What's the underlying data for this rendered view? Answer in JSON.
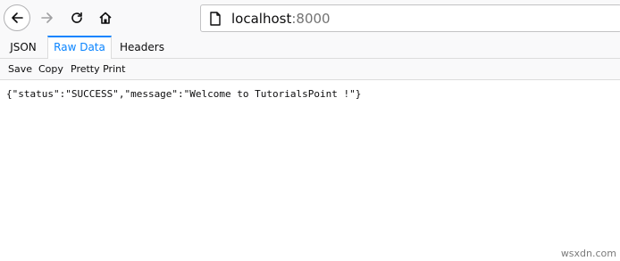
{
  "browser": {
    "url_host": "localhost",
    "url_port": ":8000",
    "icons": {
      "back": "back-arrow-icon",
      "forward": "forward-arrow-icon",
      "reload": "reload-icon",
      "home": "home-icon",
      "page": "page-info-icon"
    }
  },
  "tabs": [
    {
      "label": "JSON"
    },
    {
      "label": "Raw Data",
      "selected": true
    },
    {
      "label": "Headers"
    }
  ],
  "subtoolbar": {
    "save_label": "Save",
    "copy_label": "Copy",
    "pretty_label": "Pretty Print"
  },
  "raw_data": "{\"status\":\"SUCCESS\",\"message\":\"Welcome to TutorialsPoint !\"}",
  "watermark": "wsxdn.com",
  "colors": {
    "accent": "#0a84ff",
    "toolbar_bg": "#f9f9fa"
  }
}
